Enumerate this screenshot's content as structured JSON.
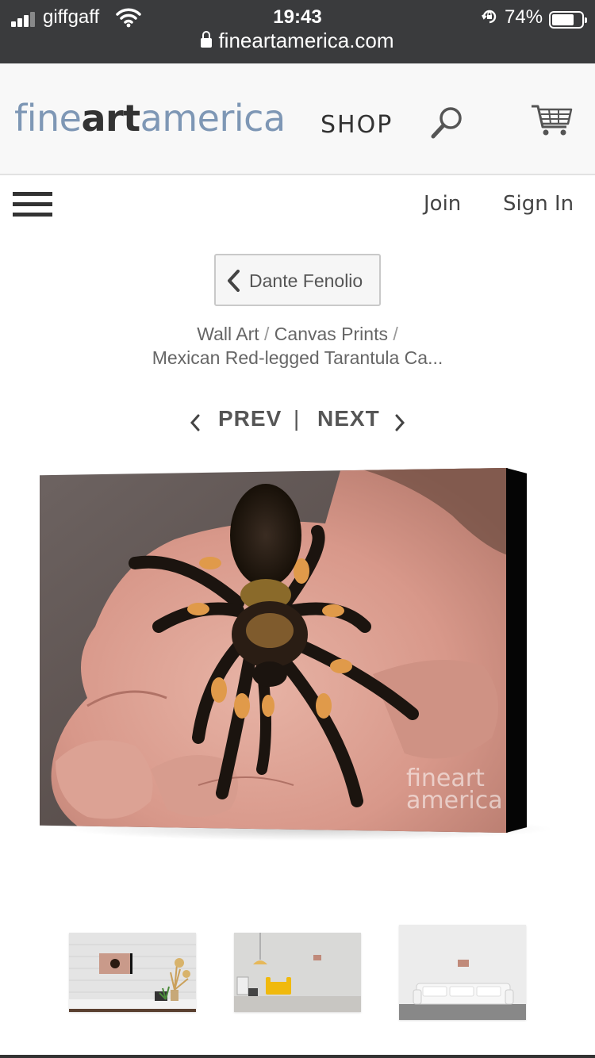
{
  "status_bar": {
    "carrier": "giffgaff",
    "time": "19:43",
    "battery_percent": "74%",
    "battery_level": 0.74,
    "url": "fineartamerica.com"
  },
  "header": {
    "logo_fine": "fine",
    "logo_art": "art",
    "logo_america": "america",
    "shop_label": "SHOP"
  },
  "nav": {
    "join_label": "Join",
    "signin_label": "Sign In"
  },
  "back_button": {
    "label": "Dante Fenolio"
  },
  "breadcrumb": {
    "item1": "Wall Art",
    "item2": "Canvas Prints",
    "current": "Mexican Red-legged Tarantula Ca...",
    "separator": "/"
  },
  "pager": {
    "prev_label": "PREV",
    "next_label": "NEXT",
    "divider": "|"
  },
  "product": {
    "watermark_line1": "fineart",
    "watermark_line2": "america"
  },
  "icons": {
    "menu": "hamburger-icon",
    "search": "search-icon",
    "cart": "cart-icon",
    "back": "chevron-left-icon",
    "prev": "chevron-left-icon",
    "next": "chevron-right-icon"
  },
  "colors": {
    "status_bar_bg": "#3a3b3d",
    "header_bg": "#f8f8f8",
    "logo_blue": "#7e97b5",
    "text_dark": "#333333"
  }
}
